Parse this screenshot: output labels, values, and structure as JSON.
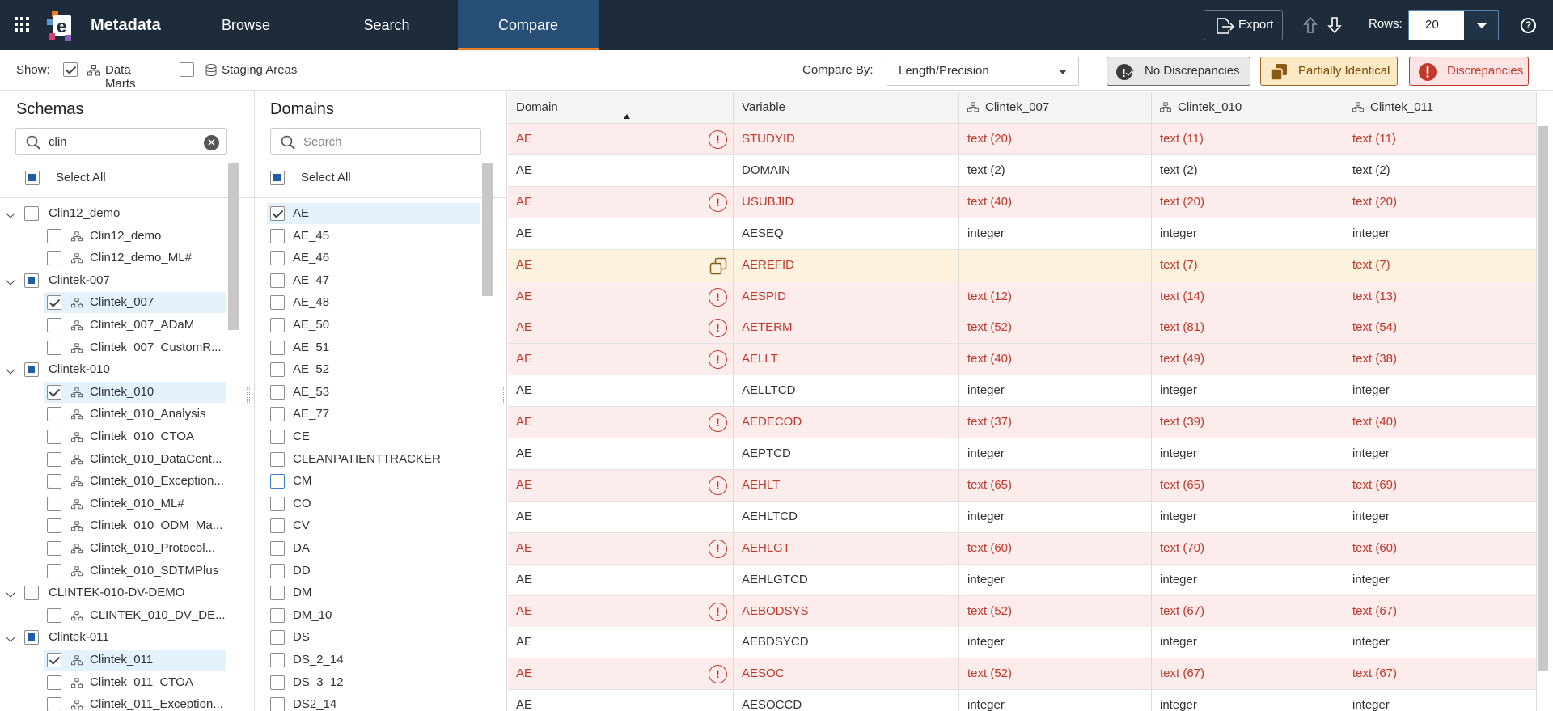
{
  "app": {
    "title": "Metadata"
  },
  "nav": {
    "tabs": [
      "Browse",
      "Search",
      "Compare"
    ],
    "active": "Compare"
  },
  "header": {
    "export_label": "Export",
    "rows_label": "Rows:",
    "rows_value": "20"
  },
  "toolbar": {
    "show_label": "Show:",
    "data_marts_label": "Data Marts",
    "data_marts_checked": true,
    "staging_areas_label": "Staging Areas",
    "staging_areas_checked": false,
    "compare_by_label": "Compare By:",
    "compare_by_value": "Length/Precision",
    "legend": {
      "no_discrepancies": "No Discrepancies",
      "partially_identical": "Partially Identical",
      "discrepancies": "Discrepancies"
    }
  },
  "schemas": {
    "title": "Schemas",
    "search_value": "clin",
    "select_all": "Select All",
    "items": [
      {
        "label": "Clin12_demo",
        "level": 0,
        "state": "unchecked"
      },
      {
        "label": "Clin12_demo",
        "level": 1,
        "state": "unchecked"
      },
      {
        "label": "Clin12_demo_ML#",
        "level": 1,
        "state": "unchecked"
      },
      {
        "label": "Clintek-007",
        "level": 0,
        "state": "partial"
      },
      {
        "label": "Clintek_007",
        "level": 1,
        "state": "checked"
      },
      {
        "label": "Clintek_007_ADaM",
        "level": 1,
        "state": "unchecked"
      },
      {
        "label": "Clintek_007_CustomR...",
        "level": 1,
        "state": "unchecked"
      },
      {
        "label": "Clintek-010",
        "level": 0,
        "state": "partial"
      },
      {
        "label": "Clintek_010",
        "level": 1,
        "state": "checked"
      },
      {
        "label": "Clintek_010_Analysis",
        "level": 1,
        "state": "unchecked"
      },
      {
        "label": "Clintek_010_CTOA",
        "level": 1,
        "state": "unchecked"
      },
      {
        "label": "Clintek_010_DataCent...",
        "level": 1,
        "state": "unchecked"
      },
      {
        "label": "Clintek_010_Exception...",
        "level": 1,
        "state": "unchecked"
      },
      {
        "label": "Clintek_010_ML#",
        "level": 1,
        "state": "unchecked"
      },
      {
        "label": "Clintek_010_ODM_Ma...",
        "level": 1,
        "state": "unchecked"
      },
      {
        "label": "Clintek_010_Protocol...",
        "level": 1,
        "state": "unchecked"
      },
      {
        "label": "Clintek_010_SDTMPlus",
        "level": 1,
        "state": "unchecked"
      },
      {
        "label": "CLINTEK-010-DV-DEMO",
        "level": 0,
        "state": "unchecked"
      },
      {
        "label": "CLINTEK_010_DV_DE...",
        "level": 1,
        "state": "unchecked"
      },
      {
        "label": "Clintek-011",
        "level": 0,
        "state": "partial"
      },
      {
        "label": "Clintek_011",
        "level": 1,
        "state": "checked"
      },
      {
        "label": "Clintek_011_CTOA",
        "level": 1,
        "state": "unchecked"
      },
      {
        "label": "Clintek_011_Exception...",
        "level": 1,
        "state": "unchecked"
      }
    ]
  },
  "domains": {
    "title": "Domains",
    "search_placeholder": "Search",
    "select_all": "Select All",
    "items": [
      {
        "label": "AE",
        "state": "checked"
      },
      {
        "label": "AE_45",
        "state": "unchecked"
      },
      {
        "label": "AE_46",
        "state": "unchecked"
      },
      {
        "label": "AE_47",
        "state": "unchecked"
      },
      {
        "label": "AE_48",
        "state": "unchecked"
      },
      {
        "label": "AE_50",
        "state": "unchecked"
      },
      {
        "label": "AE_51",
        "state": "unchecked"
      },
      {
        "label": "AE_52",
        "state": "unchecked"
      },
      {
        "label": "AE_53",
        "state": "unchecked"
      },
      {
        "label": "AE_77",
        "state": "unchecked"
      },
      {
        "label": "CE",
        "state": "unchecked"
      },
      {
        "label": "CLEANPATIENTTRACKER",
        "state": "unchecked"
      },
      {
        "label": "CM",
        "state": "focus"
      },
      {
        "label": "CO",
        "state": "unchecked"
      },
      {
        "label": "CV",
        "state": "unchecked"
      },
      {
        "label": "DA",
        "state": "unchecked"
      },
      {
        "label": "DD",
        "state": "unchecked"
      },
      {
        "label": "DM",
        "state": "unchecked"
      },
      {
        "label": "DM_10",
        "state": "unchecked"
      },
      {
        "label": "DS",
        "state": "unchecked"
      },
      {
        "label": "DS_2_14",
        "state": "unchecked"
      },
      {
        "label": "DS_3_12",
        "state": "unchecked"
      },
      {
        "label": "DS2_14",
        "state": "unchecked"
      }
    ]
  },
  "grid": {
    "columns": [
      "Domain",
      "Variable",
      "Clintek_007",
      "Clintek_010",
      "Clintek_011"
    ],
    "rows": [
      {
        "status": "disc",
        "domain": "AE",
        "variable": "STUDYID",
        "c007": "text (20)",
        "c010": "text (11)",
        "c011": "text (11)"
      },
      {
        "status": "ok",
        "domain": "AE",
        "variable": "DOMAIN",
        "c007": "text (2)",
        "c010": "text (2)",
        "c011": "text (2)"
      },
      {
        "status": "disc",
        "domain": "AE",
        "variable": "USUBJID",
        "c007": "text (40)",
        "c010": "text (20)",
        "c011": "text (20)"
      },
      {
        "status": "ok",
        "domain": "AE",
        "variable": "AESEQ",
        "c007": "integer",
        "c010": "integer",
        "c011": "integer"
      },
      {
        "status": "part",
        "domain": "AE",
        "variable": "AEREFID",
        "c007": "",
        "c010": "text (7)",
        "c011": "text (7)"
      },
      {
        "status": "disc",
        "domain": "AE",
        "variable": "AESPID",
        "c007": "text (12)",
        "c010": "text (14)",
        "c011": "text (13)"
      },
      {
        "status": "disc",
        "domain": "AE",
        "variable": "AETERM",
        "c007": "text (52)",
        "c010": "text (81)",
        "c011": "text (54)"
      },
      {
        "status": "disc",
        "domain": "AE",
        "variable": "AELLT",
        "c007": "text (40)",
        "c010": "text (49)",
        "c011": "text (38)"
      },
      {
        "status": "ok",
        "domain": "AE",
        "variable": "AELLTCD",
        "c007": "integer",
        "c010": "integer",
        "c011": "integer"
      },
      {
        "status": "disc",
        "domain": "AE",
        "variable": "AEDECOD",
        "c007": "text (37)",
        "c010": "text (39)",
        "c011": "text (40)"
      },
      {
        "status": "ok",
        "domain": "AE",
        "variable": "AEPTCD",
        "c007": "integer",
        "c010": "integer",
        "c011": "integer"
      },
      {
        "status": "disc",
        "domain": "AE",
        "variable": "AEHLT",
        "c007": "text (65)",
        "c010": "text (65)",
        "c011": "text (69)"
      },
      {
        "status": "ok",
        "domain": "AE",
        "variable": "AEHLTCD",
        "c007": "integer",
        "c010": "integer",
        "c011": "integer"
      },
      {
        "status": "disc",
        "domain": "AE",
        "variable": "AEHLGT",
        "c007": "text (60)",
        "c010": "text (70)",
        "c011": "text (60)"
      },
      {
        "status": "ok",
        "domain": "AE",
        "variable": "AEHLGTCD",
        "c007": "integer",
        "c010": "integer",
        "c011": "integer"
      },
      {
        "status": "disc",
        "domain": "AE",
        "variable": "AEBODSYS",
        "c007": "text (52)",
        "c010": "text (67)",
        "c011": "text (67)"
      },
      {
        "status": "ok",
        "domain": "AE",
        "variable": "AEBDSYCD",
        "c007": "integer",
        "c010": "integer",
        "c011": "integer"
      },
      {
        "status": "disc",
        "domain": "AE",
        "variable": "AESOC",
        "c007": "text (52)",
        "c010": "text (67)",
        "c011": "text (67)"
      },
      {
        "status": "ok",
        "domain": "AE",
        "variable": "AESOCCD",
        "c007": "integer",
        "c010": "integer",
        "c011": "integer"
      }
    ]
  },
  "colors": {
    "topbar": "#1d2b3b",
    "active_tab": "#264e77",
    "accent": "#f07d24",
    "discrepancy_text": "#c0392b",
    "discrepancy_bg": "#fcecec",
    "partial_bg": "#fdf2de"
  },
  "icons": [
    "apps-grid-icon",
    "logo-icon",
    "export-icon",
    "arrow-up-icon",
    "arrow-down-icon",
    "help-icon",
    "search-icon",
    "clear-icon",
    "chevron-down-icon",
    "network-icon",
    "exclamation-icon",
    "copy-icon",
    "sort-asc-icon"
  ]
}
